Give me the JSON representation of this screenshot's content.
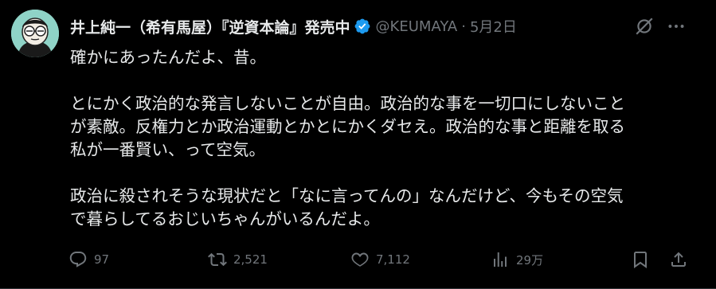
{
  "tweet": {
    "author": {
      "display_name": "井上純一（希有馬屋）『逆資本論』発売中",
      "handle": "@KEUMAYA",
      "verified": true,
      "avatar": "avatar-illustration"
    },
    "separator": "·",
    "date": "5月2日",
    "body_lines": [
      "確かにあったんだよ、昔。",
      "",
      "とにかく政治的な発言しないことが自由。政治的な事を一切口にしないこと",
      "が素敵。反権力とか政治運動とかとにかくダセえ。政治的な事と距離を取る",
      "私が一番賢い、って空気。",
      "",
      "政治に殺されそうな現状だと「なに言ってんの」なんだけど、今もその空気",
      "で暮らしてるおじいちゃんがいるんだよ。"
    ],
    "actions": {
      "reply": {
        "icon": "reply-icon",
        "count": "97"
      },
      "retweet": {
        "icon": "retweet-icon",
        "count": "2,521"
      },
      "like": {
        "icon": "heart-icon",
        "count": "7,112"
      },
      "views": {
        "icon": "bar-chart-icon",
        "count": "29万"
      },
      "bookmark": {
        "icon": "bookmark-icon"
      },
      "share": {
        "icon": "share-icon"
      }
    },
    "header_icons": [
      "grok-icon",
      "more-icon"
    ]
  },
  "colors": {
    "background": "#000000",
    "text": "#e7e9ea",
    "muted": "#71767b",
    "verified": "#1d9bf0",
    "avatar_bg": "#8fd3c7"
  }
}
